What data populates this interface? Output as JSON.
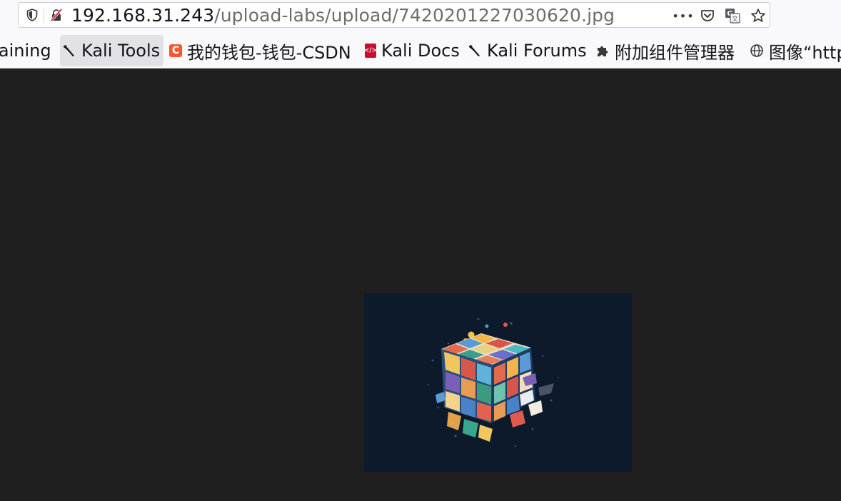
{
  "address_bar": {
    "host": "192.168.31.243",
    "path": "/upload-labs/upload/7420201227030620.jpg",
    "shield_icon": "tracking-protection-shield-icon",
    "insecure_icon": "insecure-connection-crossed-lock-icon",
    "more_icon": "page-actions-ellipsis-icon",
    "pocket_icon": "save-to-pocket-icon",
    "translate_icon": "translate-page-icon",
    "star_icon": "bookmark-star-icon"
  },
  "bookmarks": [
    {
      "label": "raining",
      "icon": "none"
    },
    {
      "label": "Kali Tools",
      "icon": "kali-dragon-icon",
      "active": true
    },
    {
      "label": "我的钱包-钱包-CSDN",
      "icon": "csdn-icon"
    },
    {
      "label": "Kali Docs",
      "icon": "kali-docs-icon"
    },
    {
      "label": "Kali Forums",
      "icon": "kali-dragon-icon"
    },
    {
      "label": "附加组件管理器",
      "icon": "puzzle-piece-icon"
    },
    {
      "label": "图像“http",
      "icon": "globe-icon"
    }
  ],
  "content": {
    "image_subject": "rubiks-cube-illustration-icon",
    "colors": {
      "page_background": "#1f1f1f",
      "image_background": "#0c1a2c",
      "toolbar_background": "#f9f9fb",
      "active_bookmark": "#e2e2e6",
      "url_host": "#15141a",
      "url_path": "#6d6d6d"
    }
  }
}
